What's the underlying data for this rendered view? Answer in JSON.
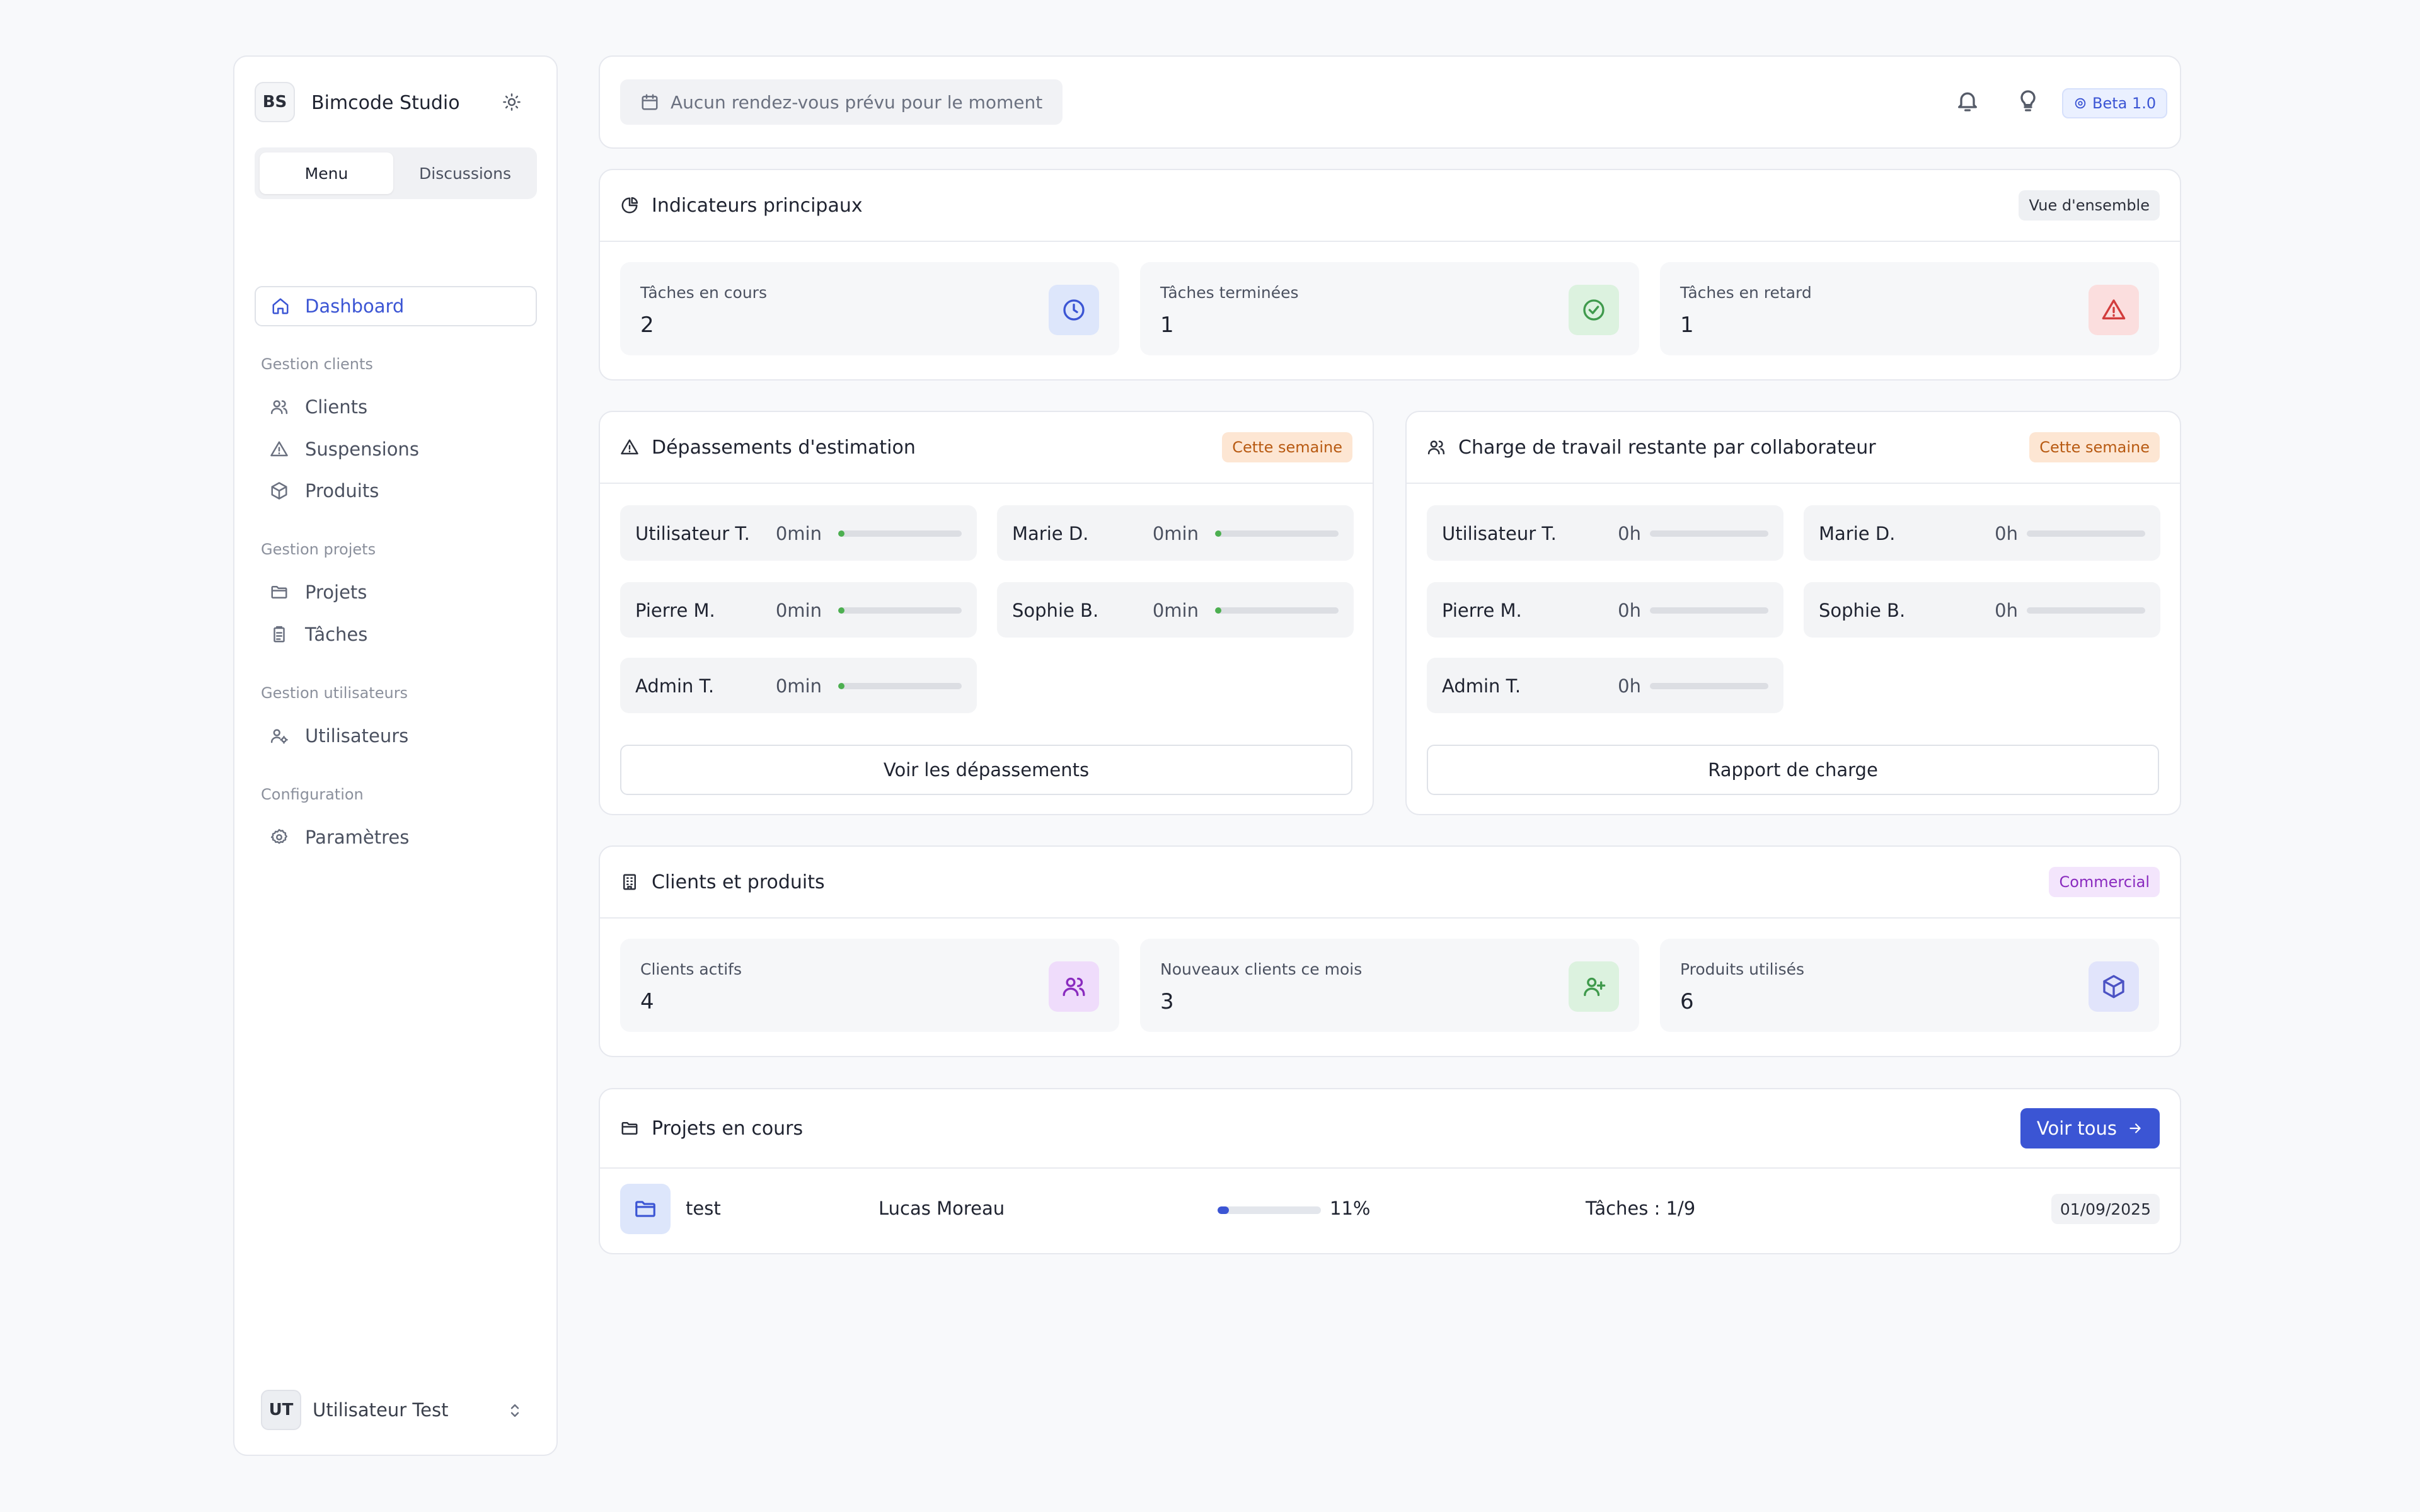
{
  "sidebar": {
    "brand": {
      "initials": "BS",
      "name": "Bimcode Studio"
    },
    "tabs": [
      {
        "label": "Menu",
        "active": true
      },
      {
        "label": "Discussions",
        "active": false
      }
    ],
    "active_item": {
      "label": "Dashboard",
      "icon": "home-icon"
    },
    "groups": [
      {
        "title": "Gestion clients",
        "items": [
          {
            "label": "Clients",
            "icon": "users-icon"
          },
          {
            "label": "Suspensions",
            "icon": "warning-icon"
          },
          {
            "label": "Produits",
            "icon": "box-icon"
          }
        ]
      },
      {
        "title": "Gestion projets",
        "items": [
          {
            "label": "Projets",
            "icon": "folder-icon"
          },
          {
            "label": "Tâches",
            "icon": "clipboard-icon"
          }
        ]
      },
      {
        "title": "Gestion utilisateurs",
        "items": [
          {
            "label": "Utilisateurs",
            "icon": "users-cog-icon"
          }
        ]
      },
      {
        "title": "Configuration",
        "items": [
          {
            "label": "Paramètres",
            "icon": "settings-icon"
          }
        ]
      }
    ],
    "user": {
      "initials": "UT",
      "name": "Utilisateur Test"
    }
  },
  "topbar": {
    "appointment": "Aucun rendez-vous prévu pour le moment",
    "beta_label": "Beta 1.0"
  },
  "indicators": {
    "title": "Indicateurs principaux",
    "badge": "Vue d'ensemble",
    "stats": [
      {
        "label": "Tâches en cours",
        "value": "2",
        "icon": "clock-icon"
      },
      {
        "label": "Tâches terminées",
        "value": "1",
        "icon": "check-circle-icon"
      },
      {
        "label": "Tâches en retard",
        "value": "1",
        "icon": "alert-triangle-icon"
      }
    ]
  },
  "overruns": {
    "title": "Dépassements d'estimation",
    "badge": "Cette semaine",
    "rows": [
      {
        "name": "Utilisateur T.",
        "value": "0min",
        "fill": 0.05
      },
      {
        "name": "Marie D.",
        "value": "0min",
        "fill": 0.05
      },
      {
        "name": "Pierre M.",
        "value": "0min",
        "fill": 0.05
      },
      {
        "name": "Sophie B.",
        "value": "0min",
        "fill": 0.05
      },
      {
        "name": "Admin T.",
        "value": "0min",
        "fill": 0.05
      }
    ],
    "button": "Voir les dépassements"
  },
  "workload": {
    "title": "Charge de travail restante par collaborateur",
    "badge": "Cette semaine",
    "rows": [
      {
        "name": "Utilisateur T.",
        "value": "0h",
        "fill": 0
      },
      {
        "name": "Marie D.",
        "value": "0h",
        "fill": 0
      },
      {
        "name": "Pierre M.",
        "value": "0h",
        "fill": 0
      },
      {
        "name": "Sophie B.",
        "value": "0h",
        "fill": 0
      },
      {
        "name": "Admin T.",
        "value": "0h",
        "fill": 0
      }
    ],
    "button": "Rapport de charge"
  },
  "clients": {
    "title": "Clients et produits",
    "badge": "Commercial",
    "stats": [
      {
        "label": "Clients actifs",
        "value": "4",
        "icon": "users-icon"
      },
      {
        "label": "Nouveaux clients ce mois",
        "value": "3",
        "icon": "user-plus-icon"
      },
      {
        "label": "Produits utilisés",
        "value": "6",
        "icon": "box-icon"
      }
    ]
  },
  "projects": {
    "title": "Projets en cours",
    "button": "Voir tous",
    "items": [
      {
        "name": "test",
        "owner": "Lucas Moreau",
        "progress": 0.11,
        "progress_label": "11%",
        "tasks": "Tâches : 1/9",
        "date": "01/09/2025"
      }
    ]
  },
  "colors": {
    "accent": "#3b55d4",
    "success": "#4caf50",
    "danger": "#d23c3c",
    "orange_badge": "#b85a12",
    "purple_badge": "#8a2bbf"
  }
}
